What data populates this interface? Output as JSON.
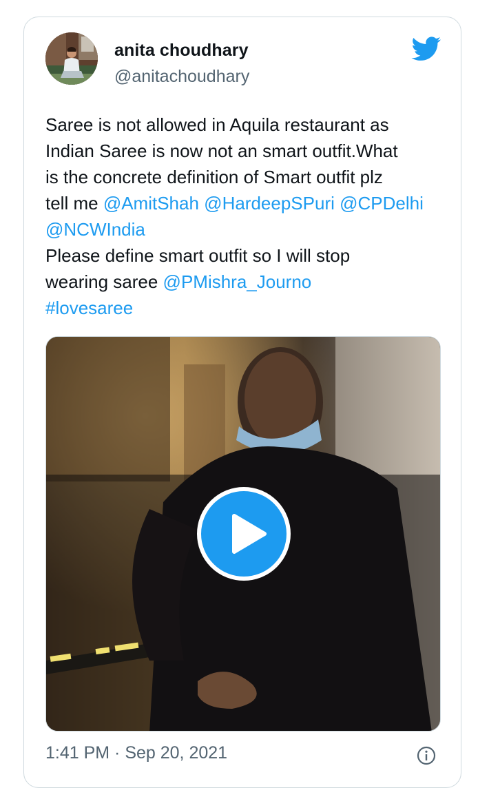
{
  "author": {
    "display_name": "anita choudhary",
    "handle": "@anitachoudhary"
  },
  "tweet": {
    "lines": [
      [
        {
          "t": "Saree is not allowed in Aquila restaurant as",
          "m": false
        }
      ],
      [
        {
          "t": "Indian Saree is now not an smart outfit.What",
          "m": false
        }
      ],
      [
        {
          "t": "is the concrete definition of Smart outfit plz",
          "m": false
        }
      ],
      [
        {
          "t": "tell me ",
          "m": false
        },
        {
          "t": "@AmitShah",
          "m": true
        },
        {
          "t": " ",
          "m": false
        },
        {
          "t": "@HardeepSPuri",
          "m": true
        },
        {
          "t": " ",
          "m": false
        },
        {
          "t": "@CPDelhi",
          "m": true
        }
      ],
      [
        {
          "t": "@NCWIndia",
          "m": true
        }
      ],
      [
        {
          "t": "Please define smart outfit so I will stop",
          "m": false
        }
      ],
      [
        {
          "t": "wearing saree ",
          "m": false
        },
        {
          "t": "@PMishra_Journo",
          "m": true
        }
      ],
      [
        {
          "t": "#lovesaree",
          "m": true
        }
      ]
    ]
  },
  "timestamp": "1:41 PM · Sep 20, 2021",
  "icons": {
    "brand": "twitter-bird-icon",
    "play": "play-icon",
    "info": "info-icon"
  },
  "colors": {
    "accent": "#1d9bf0",
    "text": "#0f1419",
    "secondary": "#536471",
    "border": "#cfd9de"
  }
}
